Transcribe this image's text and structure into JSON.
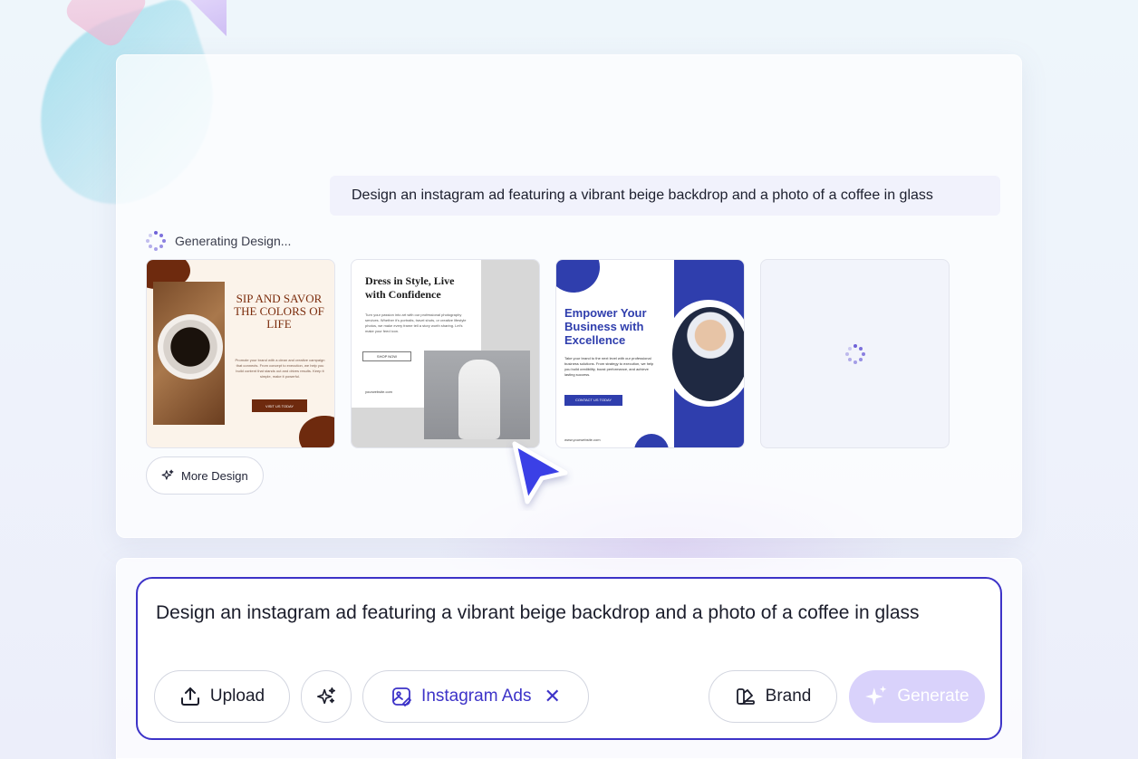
{
  "conversation": {
    "user_prompt": "Design an instagram ad featuring a vibrant beige backdrop and a photo of a coffee in glass",
    "status_text": "Generating Design..."
  },
  "designs": [
    {
      "title": "SIP AND SAVOR THE COLORS OF LIFE",
      "body": "Promote your brand with a clean and creative campaign that connects. From concept to execution, we help you build content that stands out and drives results. Keep it simple, make it powerful.",
      "button": "VISIT US TODAY"
    },
    {
      "title": "Dress in Style, Live with Confidence",
      "body": "Turn your passion into art with our professional photography services. Whether it's portraits, travel shots, or creative lifestyle photos, we make every frame tell a story worth sharing. Let's make your feed icon.",
      "button": "SHOP NOW",
      "website": "yourwebsite.com"
    },
    {
      "title": "Empower Your Business with Excellence",
      "body": "Take your brand to the next level with our professional business solutions. From strategy to execution, we help you build credibility, boost performance, and achieve lasting success.",
      "button": "CONTACT US TODAY",
      "website": "www.yourwebsite.com"
    }
  ],
  "more_design_label": "More Design",
  "composer": {
    "text": "Design an instagram ad featuring a vibrant beige backdrop and a photo of a coffee in glass",
    "upload_label": "Upload",
    "format_tag": "Instagram Ads",
    "brand_label": "Brand",
    "generate_label": "Generate"
  },
  "colors": {
    "accent": "#3d33c8",
    "generate_disabled_bg": "#d9d2fb",
    "coffee_brown": "#6e2a0e",
    "business_blue": "#2f3ead"
  },
  "icons": [
    "spinner-icon",
    "sparkle-icon",
    "upload-icon",
    "magic-icon",
    "image-edit-icon",
    "close-icon",
    "brand-icon",
    "cursor-icon"
  ]
}
